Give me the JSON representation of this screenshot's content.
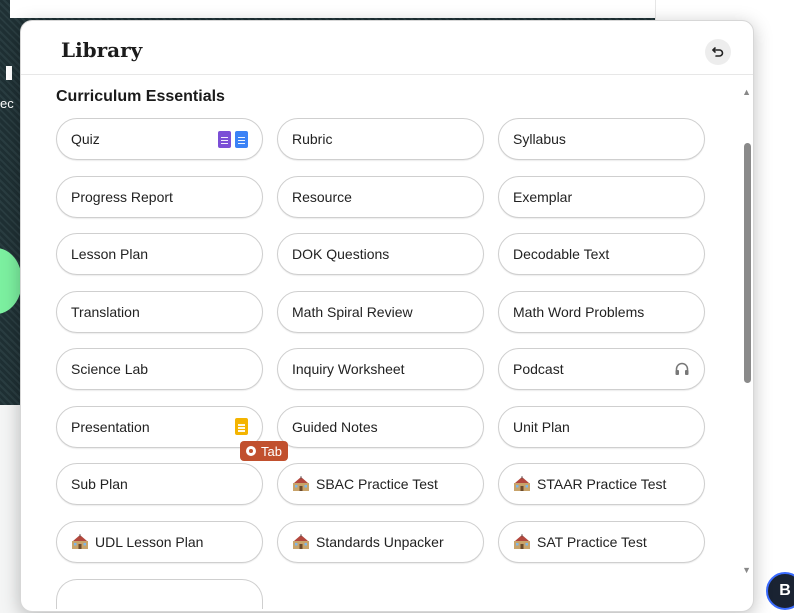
{
  "panel": {
    "title": "Library",
    "section_title": "Curriculum Essentials"
  },
  "background": {
    "fab_label": "B",
    "side_fragment": "ec"
  },
  "tab_badge": {
    "label": "Tab",
    "color": "#c1502e"
  },
  "items": [
    {
      "label": "Quiz",
      "icons": [
        "google-forms-icon",
        "google-docs-icon"
      ]
    },
    {
      "label": "Rubric"
    },
    {
      "label": "Syllabus"
    },
    {
      "label": "Progress Report"
    },
    {
      "label": "Resource"
    },
    {
      "label": "Exemplar"
    },
    {
      "label": "Lesson Plan"
    },
    {
      "label": "DOK Questions"
    },
    {
      "label": "Decodable Text"
    },
    {
      "label": "Translation"
    },
    {
      "label": "Math Spiral Review"
    },
    {
      "label": "Math Word Problems"
    },
    {
      "label": "Science Lab"
    },
    {
      "label": "Inquiry Worksheet"
    },
    {
      "label": "Podcast",
      "icons": [
        "headphones-icon"
      ]
    },
    {
      "label": "Presentation",
      "icons": [
        "google-slides-icon"
      ]
    },
    {
      "label": "Guided Notes"
    },
    {
      "label": "Unit Plan"
    },
    {
      "label": "Sub Plan"
    },
    {
      "label": "SBAC Practice Test",
      "lead_icon": "school-icon"
    },
    {
      "label": "STAAR Practice Test",
      "lead_icon": "school-icon"
    },
    {
      "label": "UDL Lesson Plan",
      "lead_icon": "school-icon"
    },
    {
      "label": "Standards Unpacker",
      "lead_icon": "school-icon"
    },
    {
      "label": "SAT Practice Test",
      "lead_icon": "school-icon"
    }
  ],
  "colors": {
    "forms": "#7b4fd6",
    "docs": "#3b82f6",
    "slides": "#f4b400",
    "pill_border": "#cfcfcf"
  }
}
